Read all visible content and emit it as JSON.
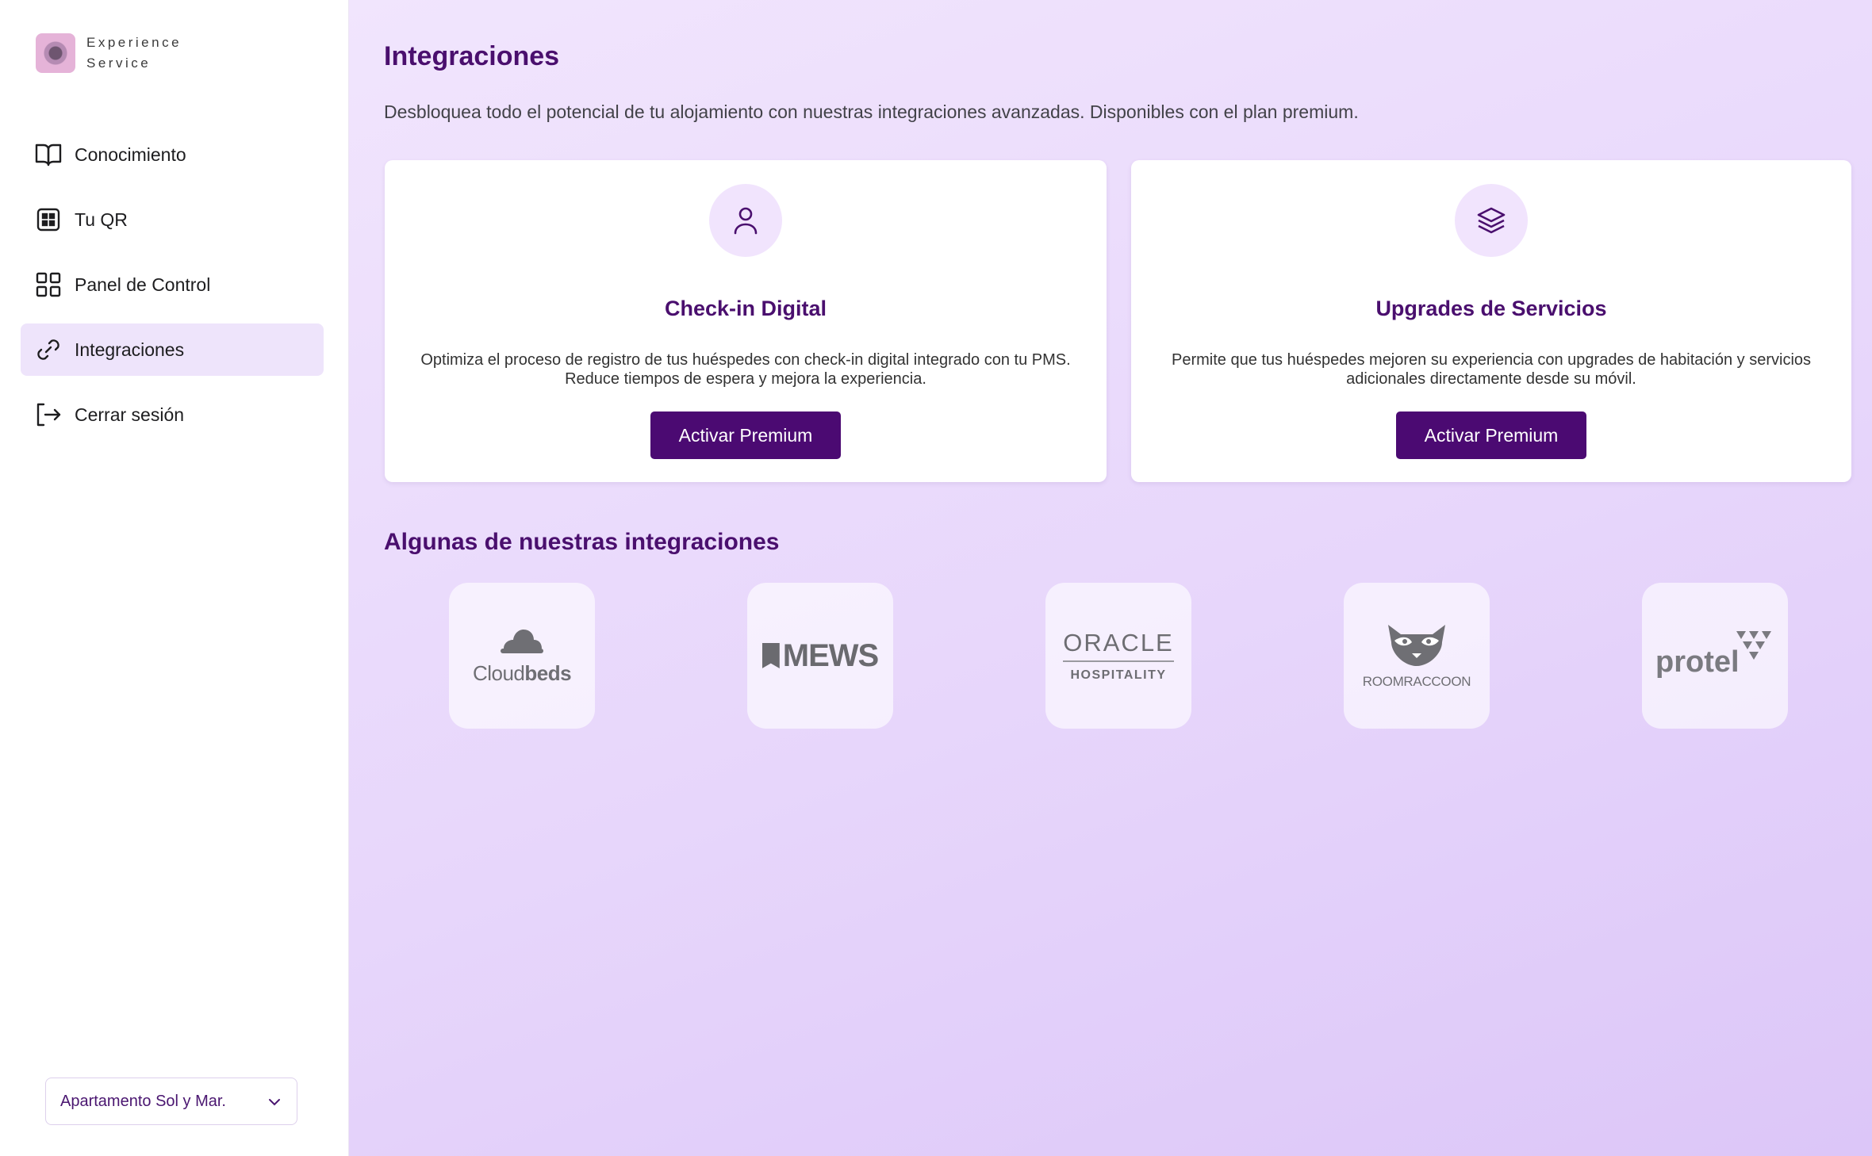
{
  "brand": {
    "line1": "Experience",
    "line2": "Service"
  },
  "sidebar": {
    "items": [
      {
        "label": "Conocimiento",
        "icon": "book-open-icon"
      },
      {
        "label": "Tu QR",
        "icon": "qr-icon"
      },
      {
        "label": "Panel de Control",
        "icon": "dashboard-grid-icon"
      },
      {
        "label": "Integraciones",
        "icon": "link-icon",
        "active": true
      },
      {
        "label": "Cerrar sesión",
        "icon": "logout-icon"
      }
    ],
    "property_select": {
      "value": "Apartamento Sol y Mar."
    }
  },
  "main": {
    "title": "Integraciones",
    "subtitle": "Desbloquea todo el potencial de tu alojamiento con nuestras integraciones avanzadas. Disponibles con el plan premium.",
    "cards": [
      {
        "icon": "user-icon",
        "title": "Check-in Digital",
        "description": "Optimiza el proceso de registro de tus huéspedes con check-in digital integrado con tu PMS. Reduce tiempos de espera y mejora la experiencia.",
        "button": "Activar Premium"
      },
      {
        "icon": "layers-icon",
        "title": "Upgrades de Servicios",
        "description": "Permite que tus huéspedes mejoren su experiencia con upgrades de habitación y servicios adicionales directamente desde su móvil.",
        "button": "Activar Premium"
      }
    ],
    "integrations_title": "Algunas de nuestras integraciones",
    "integrations": [
      {
        "name": "Cloudbeds",
        "part1": "Cloud",
        "part2": "beds"
      },
      {
        "name": "MEWS"
      },
      {
        "name": "ORACLE",
        "sub": "HOSPITALITY"
      },
      {
        "name": "ROOMRACCOON"
      },
      {
        "name": "protel"
      }
    ]
  },
  "colors": {
    "accent": "#4b0a72",
    "active_bg": "#eee4fb",
    "main_bg_start": "#f1e5fd",
    "main_bg_end": "#dcc6f8"
  }
}
